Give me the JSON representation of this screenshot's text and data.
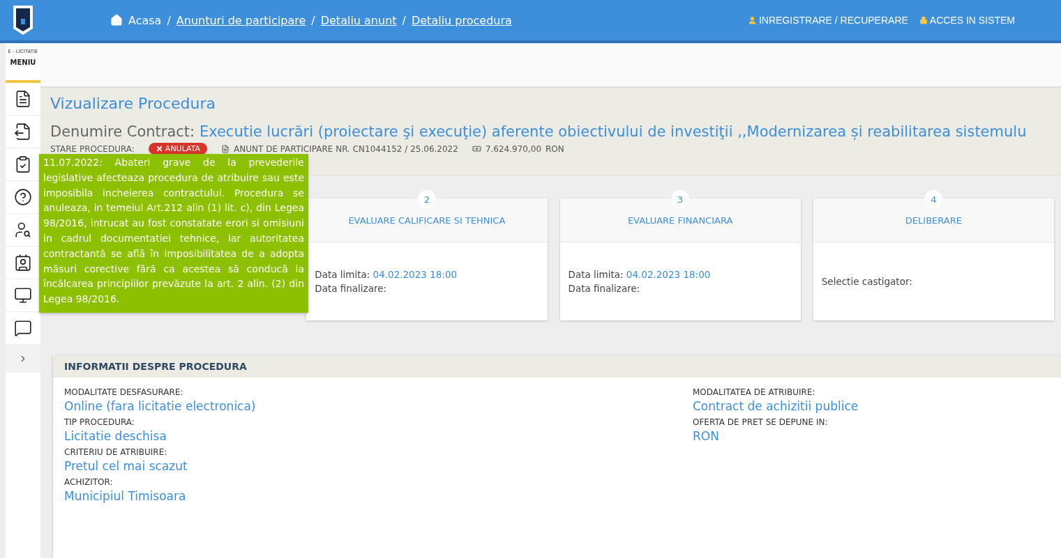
{
  "header": {
    "separator": "/",
    "breadcrumb": [
      {
        "label": "Acasa",
        "link": false
      },
      {
        "label": "Anunturi de participare",
        "link": true
      },
      {
        "label": "Detaliu anunt",
        "link": true
      },
      {
        "label": "Detaliu procedura",
        "link": true
      }
    ],
    "account_links": [
      "INREGISTRARE / RECUPERARE",
      "ACCES IN SISTEM"
    ]
  },
  "sidebar": {
    "caption": "E - LICITATIE",
    "title": "MENIU"
  },
  "page_title": "Vizualizare Procedura",
  "contract": {
    "label": "Denumire Contract:",
    "name": "Executie lucrări (proiectare şi execuţie) aferente obiectivului de investiţii ,,Modernizarea și reabilitarea sistemulu"
  },
  "status": {
    "label": "STARE PROCEDURA:",
    "badge": "ANULATA",
    "announcement": "ANUNT DE PARTICIPARE NR. CN1044152 / 25.06.2022",
    "value": "7.624.970,00",
    "currency": "RON"
  },
  "tooltip": "11.07.2022: Abateri grave de la prevederile legislative afecteaza procedura de atribuire sau este imposibila incheierea contractului. Procedura se anuleaza, in temeiul Art.212 alin (1) lit. c), din Legea 98/2016, intrucat au fost constatate erori si omisiuni in cadrul documentatiei tehnice, iar autoritatea contractantă se află în imposibilitatea de a adopta măsuri corective fără ca acestea să conducă la încălcarea principiilor prevăzute la art. 2 alin. (2) din Legea 98/2016.",
  "steps": [
    {
      "number": "2",
      "title": "EVALUARE CALIFICARE SI TEHNICA",
      "lines": [
        {
          "label": "Data limita:",
          "value": "04.02.2023 18:00"
        },
        {
          "label": "Data finalizare:"
        }
      ]
    },
    {
      "number": "3",
      "title": "EVALUARE FINANCIARA",
      "lines": [
        {
          "label": "Data limita:",
          "value": "04.02.2023 18:00"
        },
        {
          "label": "Data finalizare:"
        }
      ]
    },
    {
      "number": "4",
      "title": "DELIBERARE",
      "lines": [
        {
          "label": "Selectie castigator:"
        }
      ]
    }
  ],
  "info": {
    "title": "INFORMATII DESPRE PROCEDURA",
    "left": [
      {
        "label": "MODALITATE DESFASURARE:",
        "value": "Online (fara licitatie electronica)"
      },
      {
        "label": "TIP PROCEDURA:",
        "value": "Licitatie deschisa"
      },
      {
        "label": "CRITERIU DE ATRIBUIRE:",
        "value": "Pretul cel mai scazut"
      },
      {
        "label": "ACHIZITOR:",
        "value": "Municipiul Timisoara"
      }
    ],
    "right": [
      {
        "label": "MODALITATEA DE ATRIBUIRE:",
        "value": "Contract de achizitii publice"
      },
      {
        "label": "OFERTA DE PRET SE DEPUNE IN:",
        "value": "RON"
      }
    ]
  }
}
